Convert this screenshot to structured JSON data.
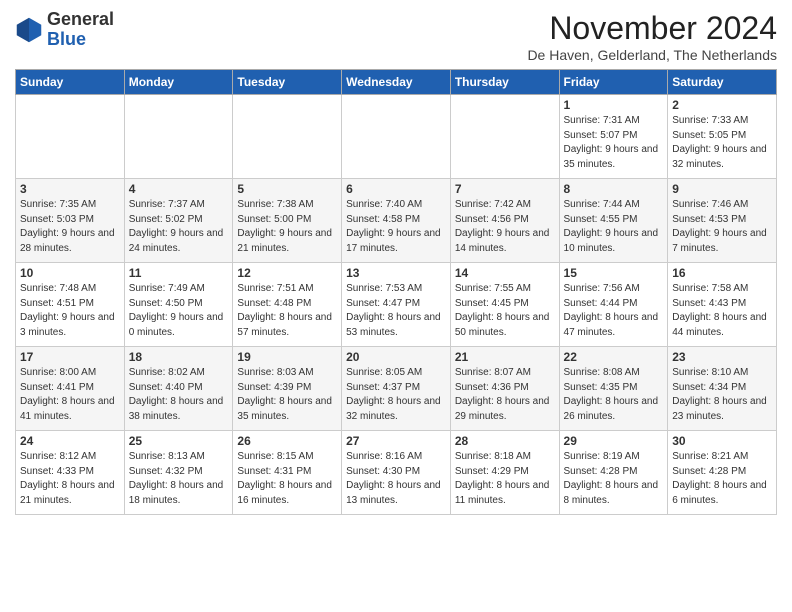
{
  "logo": {
    "general": "General",
    "blue": "Blue"
  },
  "title": "November 2024",
  "location": "De Haven, Gelderland, The Netherlands",
  "days_header": [
    "Sunday",
    "Monday",
    "Tuesday",
    "Wednesday",
    "Thursday",
    "Friday",
    "Saturday"
  ],
  "weeks": [
    [
      {
        "day": "",
        "info": ""
      },
      {
        "day": "",
        "info": ""
      },
      {
        "day": "",
        "info": ""
      },
      {
        "day": "",
        "info": ""
      },
      {
        "day": "",
        "info": ""
      },
      {
        "day": "1",
        "info": "Sunrise: 7:31 AM\nSunset: 5:07 PM\nDaylight: 9 hours and 35 minutes."
      },
      {
        "day": "2",
        "info": "Sunrise: 7:33 AM\nSunset: 5:05 PM\nDaylight: 9 hours and 32 minutes."
      }
    ],
    [
      {
        "day": "3",
        "info": "Sunrise: 7:35 AM\nSunset: 5:03 PM\nDaylight: 9 hours and 28 minutes."
      },
      {
        "day": "4",
        "info": "Sunrise: 7:37 AM\nSunset: 5:02 PM\nDaylight: 9 hours and 24 minutes."
      },
      {
        "day": "5",
        "info": "Sunrise: 7:38 AM\nSunset: 5:00 PM\nDaylight: 9 hours and 21 minutes."
      },
      {
        "day": "6",
        "info": "Sunrise: 7:40 AM\nSunset: 4:58 PM\nDaylight: 9 hours and 17 minutes."
      },
      {
        "day": "7",
        "info": "Sunrise: 7:42 AM\nSunset: 4:56 PM\nDaylight: 9 hours and 14 minutes."
      },
      {
        "day": "8",
        "info": "Sunrise: 7:44 AM\nSunset: 4:55 PM\nDaylight: 9 hours and 10 minutes."
      },
      {
        "day": "9",
        "info": "Sunrise: 7:46 AM\nSunset: 4:53 PM\nDaylight: 9 hours and 7 minutes."
      }
    ],
    [
      {
        "day": "10",
        "info": "Sunrise: 7:48 AM\nSunset: 4:51 PM\nDaylight: 9 hours and 3 minutes."
      },
      {
        "day": "11",
        "info": "Sunrise: 7:49 AM\nSunset: 4:50 PM\nDaylight: 9 hours and 0 minutes."
      },
      {
        "day": "12",
        "info": "Sunrise: 7:51 AM\nSunset: 4:48 PM\nDaylight: 8 hours and 57 minutes."
      },
      {
        "day": "13",
        "info": "Sunrise: 7:53 AM\nSunset: 4:47 PM\nDaylight: 8 hours and 53 minutes."
      },
      {
        "day": "14",
        "info": "Sunrise: 7:55 AM\nSunset: 4:45 PM\nDaylight: 8 hours and 50 minutes."
      },
      {
        "day": "15",
        "info": "Sunrise: 7:56 AM\nSunset: 4:44 PM\nDaylight: 8 hours and 47 minutes."
      },
      {
        "day": "16",
        "info": "Sunrise: 7:58 AM\nSunset: 4:43 PM\nDaylight: 8 hours and 44 minutes."
      }
    ],
    [
      {
        "day": "17",
        "info": "Sunrise: 8:00 AM\nSunset: 4:41 PM\nDaylight: 8 hours and 41 minutes."
      },
      {
        "day": "18",
        "info": "Sunrise: 8:02 AM\nSunset: 4:40 PM\nDaylight: 8 hours and 38 minutes."
      },
      {
        "day": "19",
        "info": "Sunrise: 8:03 AM\nSunset: 4:39 PM\nDaylight: 8 hours and 35 minutes."
      },
      {
        "day": "20",
        "info": "Sunrise: 8:05 AM\nSunset: 4:37 PM\nDaylight: 8 hours and 32 minutes."
      },
      {
        "day": "21",
        "info": "Sunrise: 8:07 AM\nSunset: 4:36 PM\nDaylight: 8 hours and 29 minutes."
      },
      {
        "day": "22",
        "info": "Sunrise: 8:08 AM\nSunset: 4:35 PM\nDaylight: 8 hours and 26 minutes."
      },
      {
        "day": "23",
        "info": "Sunrise: 8:10 AM\nSunset: 4:34 PM\nDaylight: 8 hours and 23 minutes."
      }
    ],
    [
      {
        "day": "24",
        "info": "Sunrise: 8:12 AM\nSunset: 4:33 PM\nDaylight: 8 hours and 21 minutes."
      },
      {
        "day": "25",
        "info": "Sunrise: 8:13 AM\nSunset: 4:32 PM\nDaylight: 8 hours and 18 minutes."
      },
      {
        "day": "26",
        "info": "Sunrise: 8:15 AM\nSunset: 4:31 PM\nDaylight: 8 hours and 16 minutes."
      },
      {
        "day": "27",
        "info": "Sunrise: 8:16 AM\nSunset: 4:30 PM\nDaylight: 8 hours and 13 minutes."
      },
      {
        "day": "28",
        "info": "Sunrise: 8:18 AM\nSunset: 4:29 PM\nDaylight: 8 hours and 11 minutes."
      },
      {
        "day": "29",
        "info": "Sunrise: 8:19 AM\nSunset: 4:28 PM\nDaylight: 8 hours and 8 minutes."
      },
      {
        "day": "30",
        "info": "Sunrise: 8:21 AM\nSunset: 4:28 PM\nDaylight: 8 hours and 6 minutes."
      }
    ]
  ]
}
